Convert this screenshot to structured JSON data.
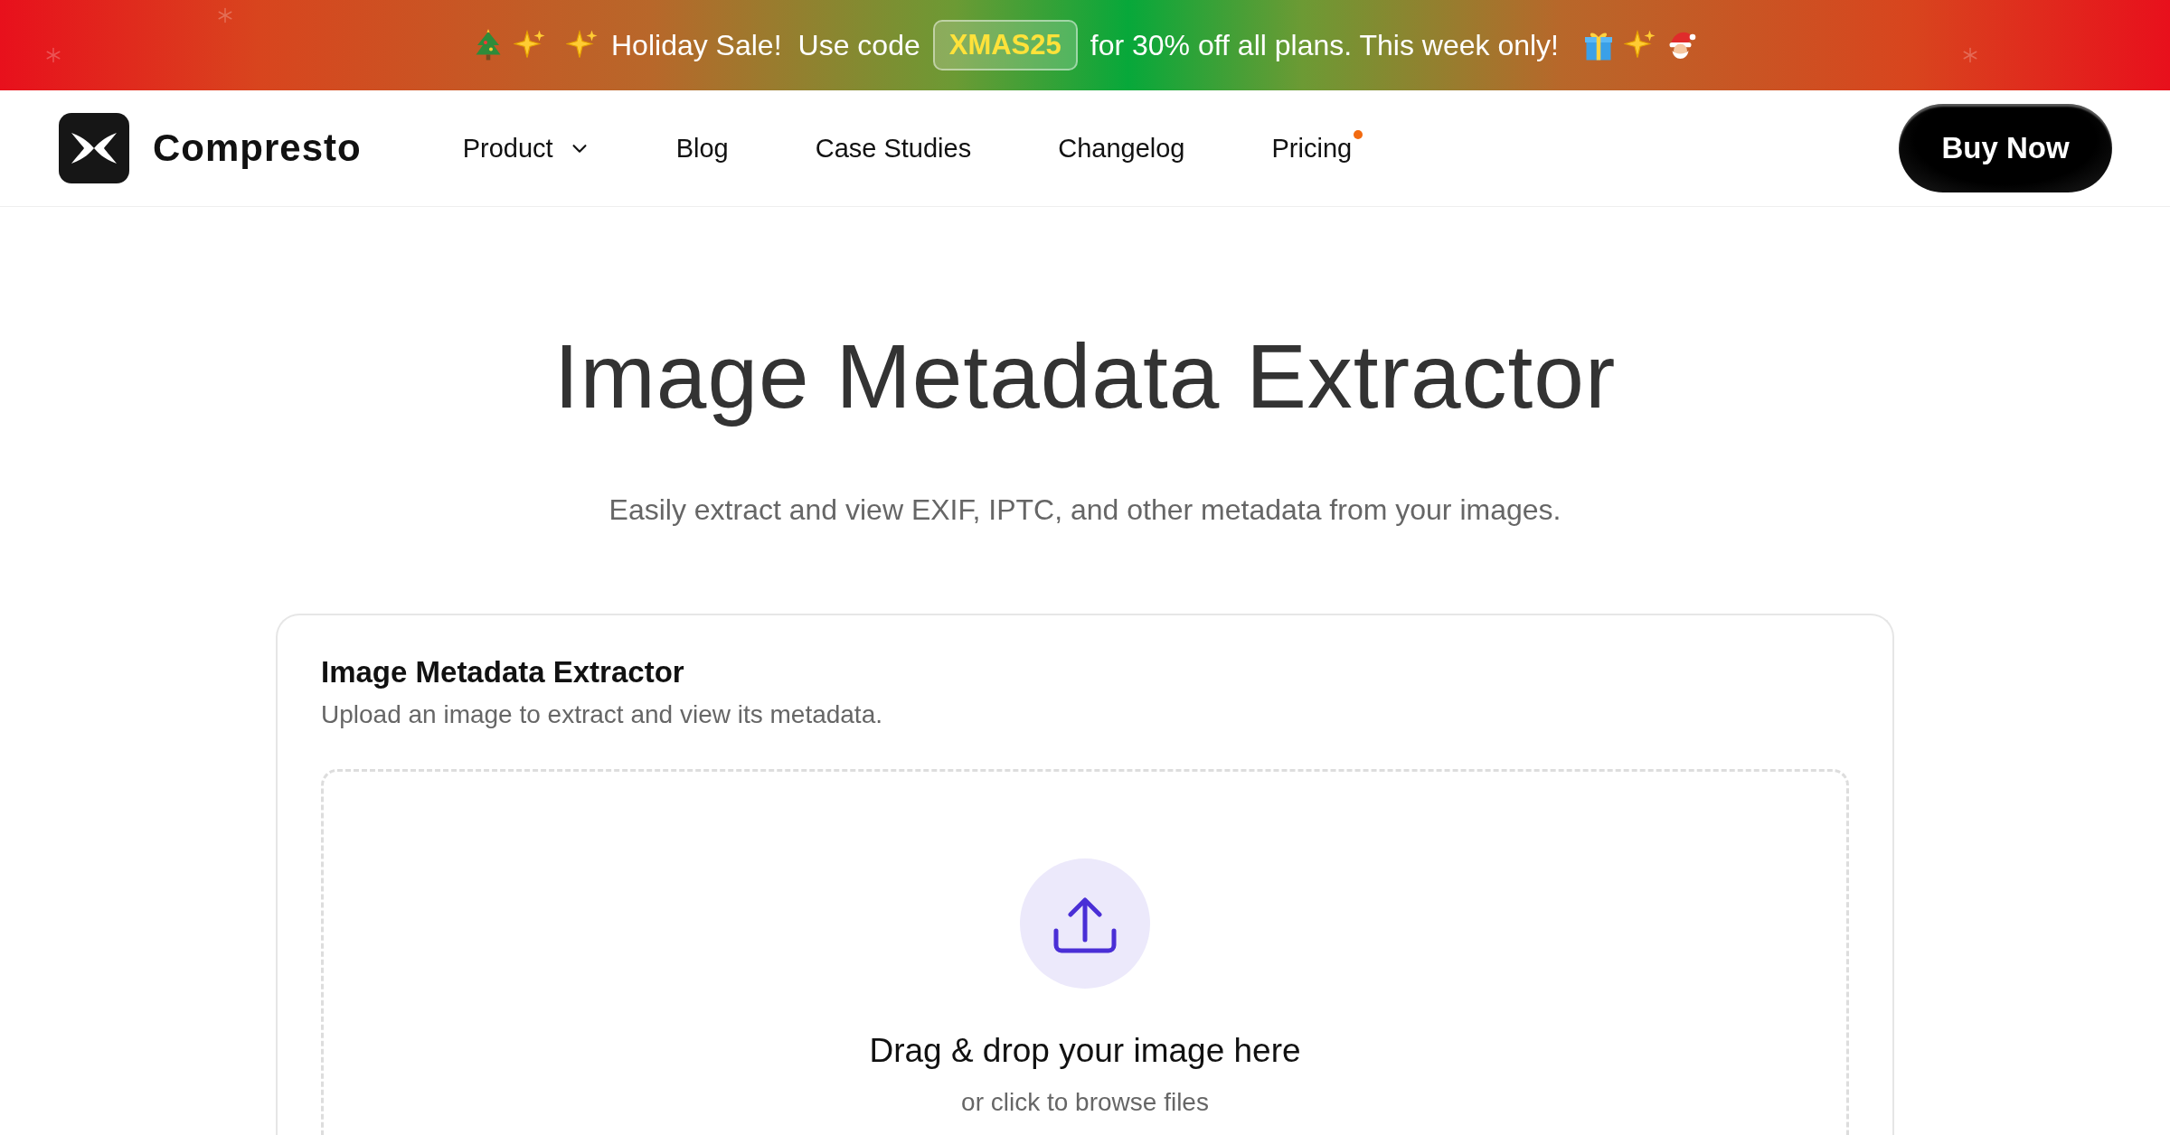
{
  "banner": {
    "headline": "Holiday Sale!",
    "prompt": "Use code",
    "code": "XMAS25",
    "offer": "for 30% off all plans. This week only!"
  },
  "header": {
    "brand": "Compresto",
    "nav": [
      {
        "label": "Product",
        "kind": "menu"
      },
      {
        "label": "Blog",
        "kind": "link"
      },
      {
        "label": "Case Studies",
        "kind": "link"
      },
      {
        "label": "Changelog",
        "kind": "link"
      },
      {
        "label": "Pricing",
        "kind": "dot"
      }
    ],
    "cta": "Buy Now"
  },
  "hero": {
    "title": "Image Metadata Extractor",
    "subtitle": "Easily extract and view EXIF, IPTC, and other metadata from your images."
  },
  "card": {
    "title": "Image Metadata Extractor",
    "description": "Upload an image to extract and view its metadata.",
    "dropzone": {
      "title": "Drag & drop your image here",
      "hint": "or click to browse files"
    }
  }
}
